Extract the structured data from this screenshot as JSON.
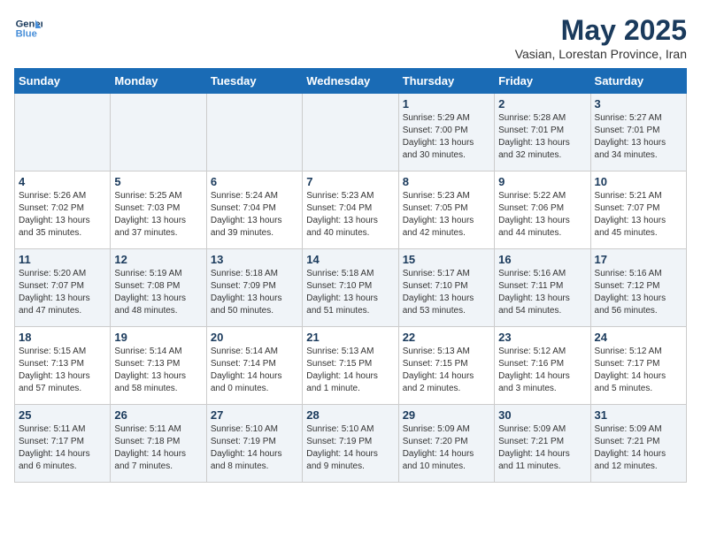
{
  "header": {
    "logo_line1": "General",
    "logo_line2": "Blue",
    "month_title": "May 2025",
    "subtitle": "Vasian, Lorestan Province, Iran"
  },
  "weekdays": [
    "Sunday",
    "Monday",
    "Tuesday",
    "Wednesday",
    "Thursday",
    "Friday",
    "Saturday"
  ],
  "weeks": [
    [
      {
        "day": "",
        "info": ""
      },
      {
        "day": "",
        "info": ""
      },
      {
        "day": "",
        "info": ""
      },
      {
        "day": "",
        "info": ""
      },
      {
        "day": "1",
        "info": "Sunrise: 5:29 AM\nSunset: 7:00 PM\nDaylight: 13 hours\nand 30 minutes."
      },
      {
        "day": "2",
        "info": "Sunrise: 5:28 AM\nSunset: 7:01 PM\nDaylight: 13 hours\nand 32 minutes."
      },
      {
        "day": "3",
        "info": "Sunrise: 5:27 AM\nSunset: 7:01 PM\nDaylight: 13 hours\nand 34 minutes."
      }
    ],
    [
      {
        "day": "4",
        "info": "Sunrise: 5:26 AM\nSunset: 7:02 PM\nDaylight: 13 hours\nand 35 minutes."
      },
      {
        "day": "5",
        "info": "Sunrise: 5:25 AM\nSunset: 7:03 PM\nDaylight: 13 hours\nand 37 minutes."
      },
      {
        "day": "6",
        "info": "Sunrise: 5:24 AM\nSunset: 7:04 PM\nDaylight: 13 hours\nand 39 minutes."
      },
      {
        "day": "7",
        "info": "Sunrise: 5:23 AM\nSunset: 7:04 PM\nDaylight: 13 hours\nand 40 minutes."
      },
      {
        "day": "8",
        "info": "Sunrise: 5:23 AM\nSunset: 7:05 PM\nDaylight: 13 hours\nand 42 minutes."
      },
      {
        "day": "9",
        "info": "Sunrise: 5:22 AM\nSunset: 7:06 PM\nDaylight: 13 hours\nand 44 minutes."
      },
      {
        "day": "10",
        "info": "Sunrise: 5:21 AM\nSunset: 7:07 PM\nDaylight: 13 hours\nand 45 minutes."
      }
    ],
    [
      {
        "day": "11",
        "info": "Sunrise: 5:20 AM\nSunset: 7:07 PM\nDaylight: 13 hours\nand 47 minutes."
      },
      {
        "day": "12",
        "info": "Sunrise: 5:19 AM\nSunset: 7:08 PM\nDaylight: 13 hours\nand 48 minutes."
      },
      {
        "day": "13",
        "info": "Sunrise: 5:18 AM\nSunset: 7:09 PM\nDaylight: 13 hours\nand 50 minutes."
      },
      {
        "day": "14",
        "info": "Sunrise: 5:18 AM\nSunset: 7:10 PM\nDaylight: 13 hours\nand 51 minutes."
      },
      {
        "day": "15",
        "info": "Sunrise: 5:17 AM\nSunset: 7:10 PM\nDaylight: 13 hours\nand 53 minutes."
      },
      {
        "day": "16",
        "info": "Sunrise: 5:16 AM\nSunset: 7:11 PM\nDaylight: 13 hours\nand 54 minutes."
      },
      {
        "day": "17",
        "info": "Sunrise: 5:16 AM\nSunset: 7:12 PM\nDaylight: 13 hours\nand 56 minutes."
      }
    ],
    [
      {
        "day": "18",
        "info": "Sunrise: 5:15 AM\nSunset: 7:13 PM\nDaylight: 13 hours\nand 57 minutes."
      },
      {
        "day": "19",
        "info": "Sunrise: 5:14 AM\nSunset: 7:13 PM\nDaylight: 13 hours\nand 58 minutes."
      },
      {
        "day": "20",
        "info": "Sunrise: 5:14 AM\nSunset: 7:14 PM\nDaylight: 14 hours\nand 0 minutes."
      },
      {
        "day": "21",
        "info": "Sunrise: 5:13 AM\nSunset: 7:15 PM\nDaylight: 14 hours\nand 1 minute."
      },
      {
        "day": "22",
        "info": "Sunrise: 5:13 AM\nSunset: 7:15 PM\nDaylight: 14 hours\nand 2 minutes."
      },
      {
        "day": "23",
        "info": "Sunrise: 5:12 AM\nSunset: 7:16 PM\nDaylight: 14 hours\nand 3 minutes."
      },
      {
        "day": "24",
        "info": "Sunrise: 5:12 AM\nSunset: 7:17 PM\nDaylight: 14 hours\nand 5 minutes."
      }
    ],
    [
      {
        "day": "25",
        "info": "Sunrise: 5:11 AM\nSunset: 7:17 PM\nDaylight: 14 hours\nand 6 minutes."
      },
      {
        "day": "26",
        "info": "Sunrise: 5:11 AM\nSunset: 7:18 PM\nDaylight: 14 hours\nand 7 minutes."
      },
      {
        "day": "27",
        "info": "Sunrise: 5:10 AM\nSunset: 7:19 PM\nDaylight: 14 hours\nand 8 minutes."
      },
      {
        "day": "28",
        "info": "Sunrise: 5:10 AM\nSunset: 7:19 PM\nDaylight: 14 hours\nand 9 minutes."
      },
      {
        "day": "29",
        "info": "Sunrise: 5:09 AM\nSunset: 7:20 PM\nDaylight: 14 hours\nand 10 minutes."
      },
      {
        "day": "30",
        "info": "Sunrise: 5:09 AM\nSunset: 7:21 PM\nDaylight: 14 hours\nand 11 minutes."
      },
      {
        "day": "31",
        "info": "Sunrise: 5:09 AM\nSunset: 7:21 PM\nDaylight: 14 hours\nand 12 minutes."
      }
    ]
  ]
}
